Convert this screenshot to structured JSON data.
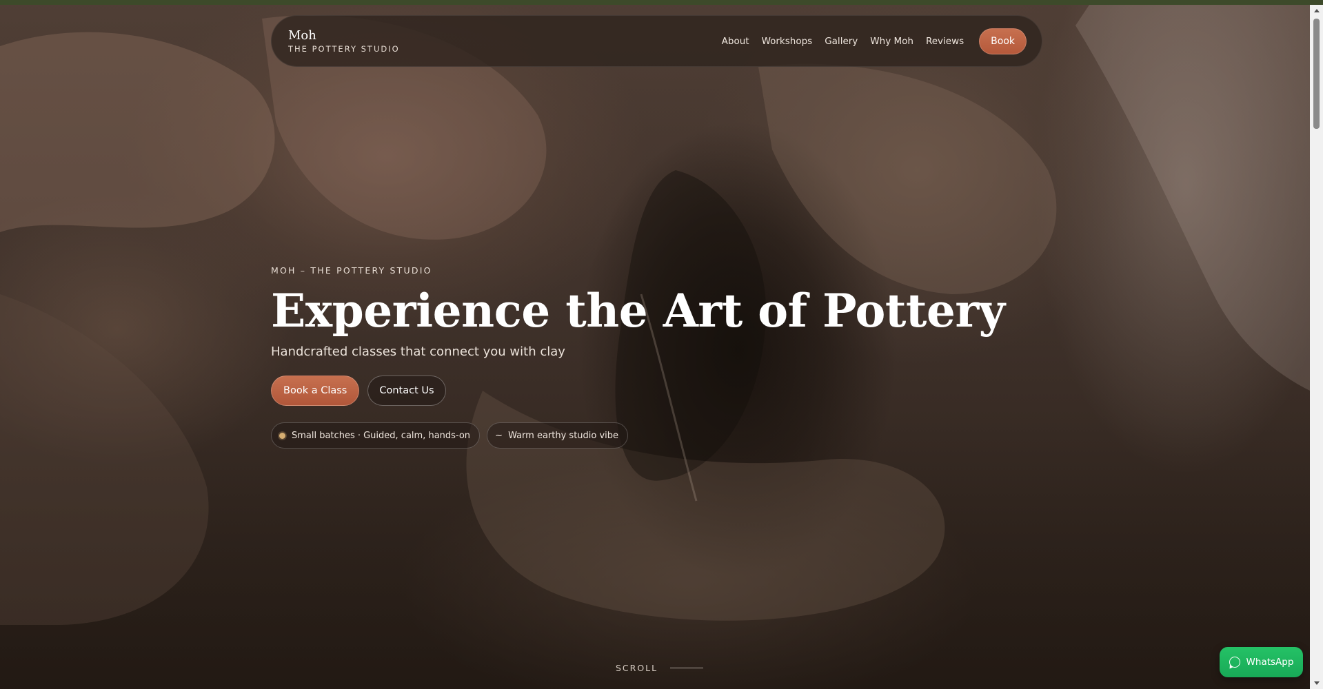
{
  "nav": {
    "brand_name": "Moh",
    "brand_sub": "THE POTTERY STUDIO",
    "links": [
      "About",
      "Workshops",
      "Gallery",
      "Why Moh",
      "Reviews"
    ],
    "book_label": "Book"
  },
  "hero": {
    "eyebrow": "MOH – THE POTTERY STUDIO",
    "headline": "Experience the Art of Pottery",
    "subhead": "Handcrafted classes that connect you with clay",
    "cta_primary": "Book a Class",
    "cta_secondary": "Contact Us",
    "pills": [
      {
        "icon": "dot-icon",
        "label": "Small batches · Guided, calm, hands-on"
      },
      {
        "icon": "tilde-icon",
        "glyph": "~",
        "label": "Warm earthy studio vibe"
      }
    ],
    "scroll_label": "SCROLL"
  },
  "whatsapp": {
    "label": "WhatsApp",
    "color": "#1fb75e"
  },
  "colors": {
    "accent": "#c0664a",
    "dot": "#d6ae72"
  }
}
